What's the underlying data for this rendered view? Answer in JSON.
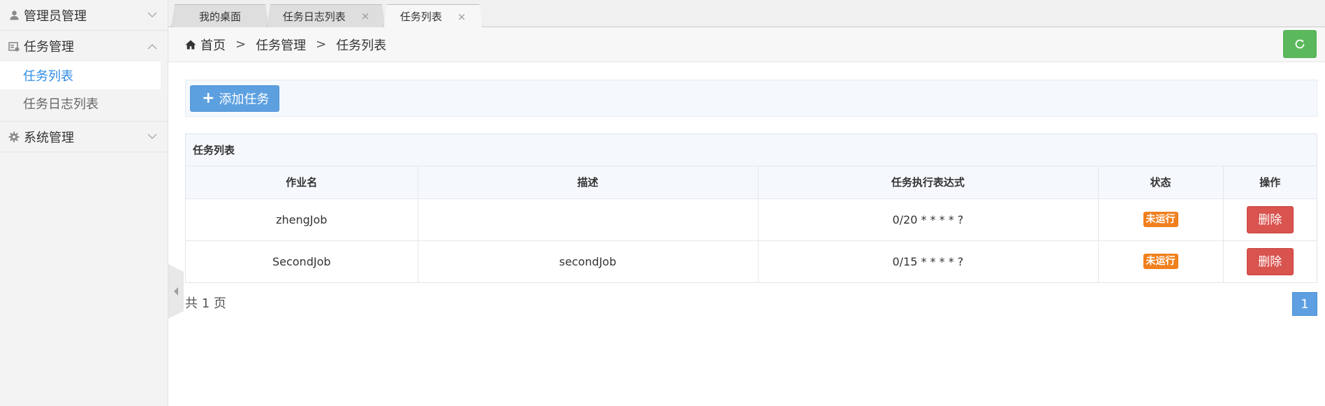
{
  "sidebar": {
    "groups": [
      {
        "label": "管理员管理",
        "icon": "user-icon",
        "expanded": false
      },
      {
        "label": "任务管理",
        "icon": "task-icon",
        "expanded": true,
        "items": [
          {
            "label": "任务列表",
            "active": true
          },
          {
            "label": "任务日志列表",
            "active": false
          }
        ]
      },
      {
        "label": "系统管理",
        "icon": "gear-icon",
        "expanded": false
      }
    ]
  },
  "tabs": [
    {
      "label": "我的桌面",
      "closable": false,
      "active": false
    },
    {
      "label": "任务日志列表",
      "closable": true,
      "active": false,
      "close": "×"
    },
    {
      "label": "任务列表",
      "closable": true,
      "active": true,
      "close": "×"
    }
  ],
  "breadcrumb": {
    "items": [
      "首页",
      "任务管理",
      "任务列表"
    ],
    "separator": ">"
  },
  "toolbar": {
    "add_label": "添加任务",
    "add_icon": "+"
  },
  "panel": {
    "title": "任务列表",
    "columns": [
      "作业名",
      "描述",
      "任务执行表达式",
      "状态",
      "操作"
    ],
    "rows": [
      {
        "name": "zhengJob",
        "desc": "",
        "cron": "0/20 * * * * ?",
        "status": "未运行",
        "action": "删除"
      },
      {
        "name": "SecondJob",
        "desc": "secondJob",
        "cron": "0/15 * * * * ?",
        "status": "未运行",
        "action": "删除"
      }
    ]
  },
  "pager": {
    "summary": "共 1 页",
    "current": "1"
  },
  "colors": {
    "accent": "#2f8ce5",
    "primary_button": "#5da0e0",
    "danger_button": "#d9534f",
    "success_button": "#5cb85c",
    "status_badge": "#f0801e"
  }
}
